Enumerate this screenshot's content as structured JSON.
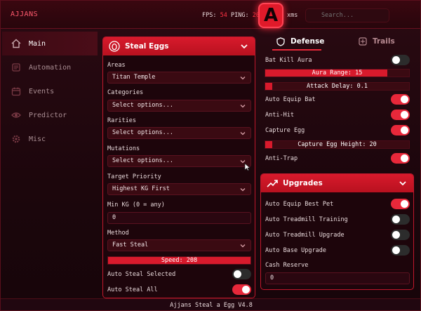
{
  "app": {
    "title": "AJJANS"
  },
  "stats": {
    "fps_label": "FPS:",
    "fps_value": "54",
    "ping_label": "PING:",
    "ping_value": "20",
    "extra": "xms"
  },
  "logo": {
    "letter": "A"
  },
  "search": {
    "placeholder": "Search..."
  },
  "sidebar": {
    "items": [
      {
        "label": "Main",
        "icon": "home-icon",
        "active": true
      },
      {
        "label": "Automation",
        "icon": "automation-icon",
        "active": false
      },
      {
        "label": "Events",
        "icon": "calendar-icon",
        "active": false
      },
      {
        "label": "Predictor",
        "icon": "eye-icon",
        "active": false
      },
      {
        "label": "Misc",
        "icon": "gear-icon",
        "active": false
      }
    ]
  },
  "steal_eggs": {
    "title": "Steal Eggs",
    "areas": {
      "label": "Areas",
      "value": "Titan Temple"
    },
    "categories": {
      "label": "Categories",
      "value": "Select options..."
    },
    "rarities": {
      "label": "Rarities",
      "value": "Select options..."
    },
    "mutations": {
      "label": "Mutations",
      "value": "Select options..."
    },
    "target_priority": {
      "label": "Target Priority",
      "value": "Highest KG First"
    },
    "min_kg": {
      "label": "Min KG (0 = any)",
      "value": "0"
    },
    "method": {
      "label": "Method",
      "value": "Fast Steal"
    },
    "speed": {
      "text": "Speed: 208",
      "level": 1.0
    },
    "auto_steal_selected": {
      "label": "Auto Steal Selected",
      "on": false
    },
    "auto_steal_all": {
      "label": "Auto Steal All",
      "on": true
    }
  },
  "tabs": {
    "defense": "Defense",
    "trails": "Trails"
  },
  "defense": {
    "bat_kill_aura": {
      "label": "Bat Kill Aura",
      "on": false
    },
    "aura_range": {
      "text": "Aura Range: 15",
      "level": 0.85
    },
    "attack_delay": {
      "text": "Attack Delay: 0.1",
      "level": 0.05
    },
    "auto_equip_bat": {
      "label": "Auto Equip Bat",
      "on": true
    },
    "anti_hit": {
      "label": "Anti-Hit",
      "on": true
    },
    "capture_egg": {
      "label": "Capture Egg",
      "on": true
    },
    "capture_egg_height": {
      "text": "Capture Egg Height: 20",
      "level": 0.05
    },
    "anti_trap": {
      "label": "Anti-Trap",
      "on": true
    }
  },
  "upgrades": {
    "title": "Upgrades",
    "auto_equip_best_pet": {
      "label": "Auto Equip Best Pet",
      "on": true
    },
    "auto_treadmill_training": {
      "label": "Auto Treadmill Training",
      "on": false
    },
    "auto_treadmill_upgrade": {
      "label": "Auto Treadmill Upgrade",
      "on": false
    },
    "auto_base_upgrade": {
      "label": "Auto Base Upgrade",
      "on": false
    },
    "cash_reserve": {
      "label": "Cash Reserve",
      "value": "0"
    }
  },
  "footer": {
    "text": "Ajjans Steal a Egg V4.8"
  },
  "colors": {
    "accent": "#e01a2a",
    "background": "#1c060c",
    "toggle_off": "#2c2c2c"
  }
}
